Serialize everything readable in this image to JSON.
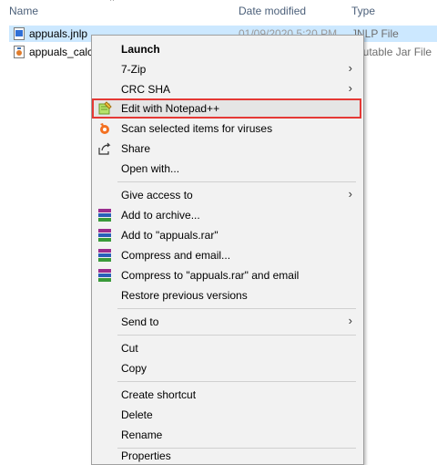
{
  "columns": {
    "name": "Name",
    "date": "Date modified",
    "type": "Type",
    "sort_indicator": "^"
  },
  "files": [
    {
      "name": "appuals.jnlp",
      "date": "01/09/2020 5:20 PM",
      "type": "JNLP File",
      "icon": "jnlp-file-icon",
      "selected": true
    },
    {
      "name": "appuals_calc",
      "date": "",
      "type": "ecutable Jar File",
      "icon": "jar-file-icon",
      "selected": false
    }
  ],
  "menu": {
    "launch": "Launch",
    "zip": "7-Zip",
    "crc": "CRC SHA",
    "notepad": "Edit with Notepad++",
    "scan": "Scan selected items for viruses",
    "share": "Share",
    "open_with": "Open with...",
    "give_access": "Give access to",
    "add_archive": "Add to archive...",
    "add_rar": "Add to \"appuals.rar\"",
    "compress_email": "Compress and email...",
    "compress_rar_email": "Compress to \"appuals.rar\" and email",
    "restore": "Restore previous versions",
    "send_to": "Send to",
    "cut": "Cut",
    "copy": "Copy",
    "create_shortcut": "Create shortcut",
    "delete": "Delete",
    "rename": "Rename",
    "properties": "Properties",
    "submenu_arrow": "›"
  },
  "colors": {
    "selection": "#cce8ff",
    "highlight_border": "#e53935",
    "menu_bg": "#f2f2f2"
  }
}
